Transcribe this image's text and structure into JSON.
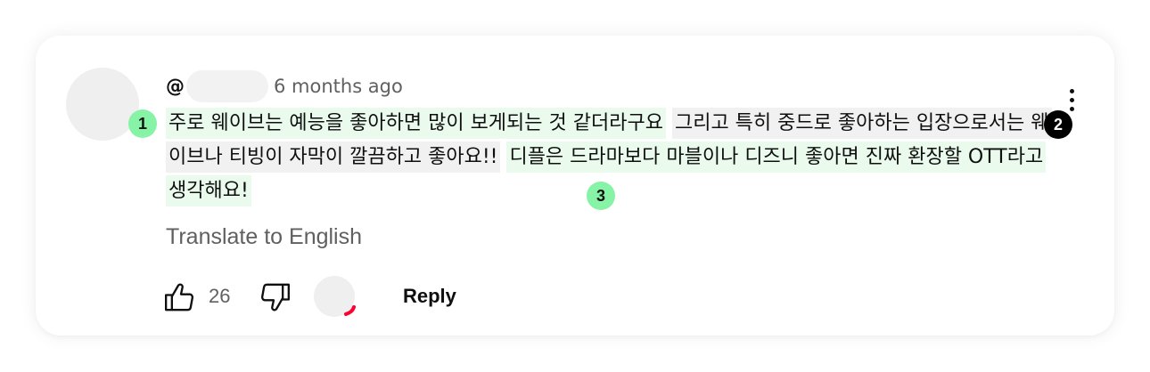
{
  "comment": {
    "handle_prefix": "@",
    "timestamp": "6 months ago",
    "segments": [
      {
        "text": "주로 웨이브는 예능을 좋아하면 많이 보게되는 것 같더라구요",
        "style": "green"
      },
      {
        "text": "그리고 특히 중드로 좋아하는 입장으로서는 웨이브나 티빙이 자막이 깔끔하고 좋아요!!",
        "style": "gray"
      },
      {
        "text": "디플은 드라마보다 마블이나 디즈니 좋아면 진짜 환장할 OTT라고 생각해요!",
        "style": "green"
      }
    ],
    "badges": [
      "1",
      "2",
      "3"
    ],
    "translate_label": "Translate to English",
    "like_count": "26",
    "reply_label": "Reply"
  },
  "colors": {
    "highlight_green": "#eafbee",
    "highlight_gray": "#f1f1f1",
    "badge_green": "#86f3a6",
    "badge_black": "#000000",
    "heart_red": "#ff0033",
    "secondary_text": "#606060"
  },
  "icons": [
    "more-vert-icon",
    "thumbs-up-icon",
    "thumbs-down-icon",
    "creator-heart-icon"
  ]
}
